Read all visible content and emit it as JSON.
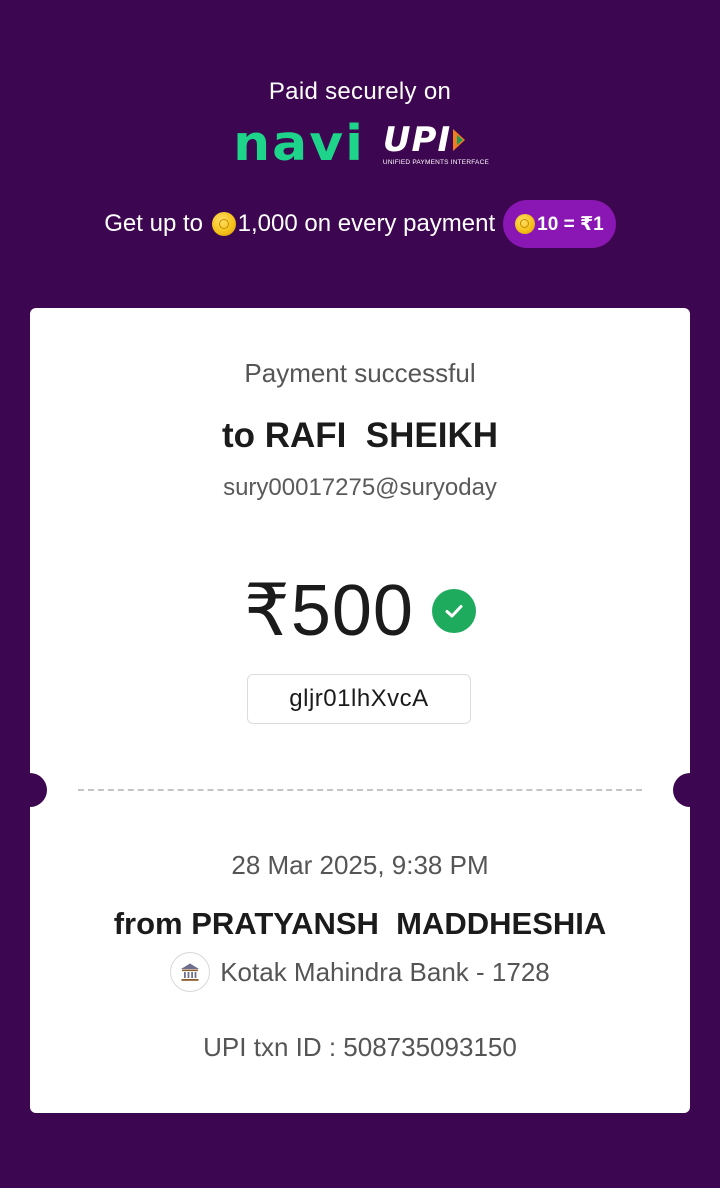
{
  "header": {
    "tagline": "Paid securely on",
    "navi_logo": "navi",
    "upi_logo": "UPI",
    "upi_subtitle": "UNIFIED PAYMENTS INTERFACE"
  },
  "promo": {
    "text_prefix": "Get up to ",
    "text_amount": "1,000 on every payment",
    "pill_text": "10 = ₹1"
  },
  "receipt": {
    "status": "Payment successful",
    "payee_name": "to RAFI  SHEIKH",
    "payee_vpa": "sury00017275@suryoday",
    "amount": "₹500",
    "reference": "gljr01lhXvcA",
    "datetime": "28 Mar 2025, 9:38 PM",
    "payer_name": "from PRATYANSH  MADDHESHIA",
    "bank": "Kotak Mahindra Bank - 1728",
    "upi_txn_id": "UPI txn ID : 508735093150"
  },
  "colors": {
    "background": "#3d0650",
    "navi_green": "#1ed38a",
    "promo_pill": "#8a17b4",
    "success_green": "#1fab5e",
    "card": "#ffffff"
  },
  "icons": [
    "coin-icon",
    "check-circle-icon",
    "bank-icon"
  ]
}
